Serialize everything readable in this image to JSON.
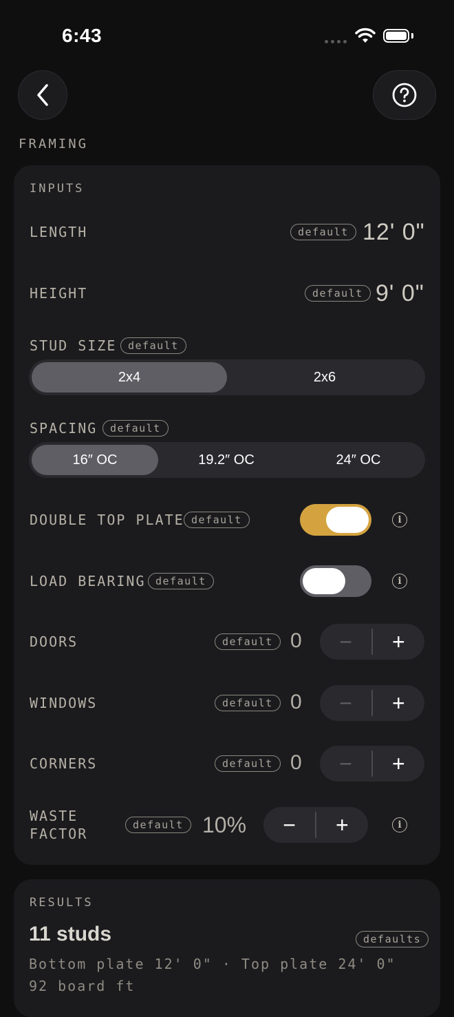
{
  "status": {
    "time": "6:43"
  },
  "header": {
    "back_icon": "chevron-left-icon",
    "help_icon": "question-circle-icon",
    "section": "FRAMING"
  },
  "inputs": {
    "title": "INPUTS",
    "default_tag": "default",
    "length": {
      "label": "LENGTH",
      "value": "12' 0\""
    },
    "height": {
      "label": "HEIGHT",
      "value": "9' 0\""
    },
    "stud_size": {
      "label": "STUD SIZE",
      "options": [
        "2x4",
        "2x6"
      ],
      "selected": "2x4"
    },
    "spacing": {
      "label": "SPACING",
      "options": [
        "16″ OC",
        "19.2″ OC",
        "24″ OC"
      ],
      "selected": "16″ OC"
    },
    "double_top_plate": {
      "label": "DOUBLE TOP PLATE",
      "on": true
    },
    "load_bearing": {
      "label": "LOAD BEARING",
      "on": false
    },
    "doors": {
      "label": "DOORS",
      "value": "0"
    },
    "windows": {
      "label": "WINDOWS",
      "value": "0"
    },
    "corners": {
      "label": "CORNERS",
      "value": "0"
    },
    "waste_factor": {
      "label_line1": "WASTE",
      "label_line2": "FACTOR",
      "value": "10%"
    },
    "minus": "−",
    "plus": "+",
    "info_glyph": "i",
    "toggle_on_color": "#d4a23f"
  },
  "results": {
    "title": "RESULTS",
    "studs": "11 studs",
    "defaults_tag": "defaults",
    "plates": "Bottom plate 12' 0\"  ·  Top plate 24' 0\"",
    "board_ft": "92 board ft"
  }
}
